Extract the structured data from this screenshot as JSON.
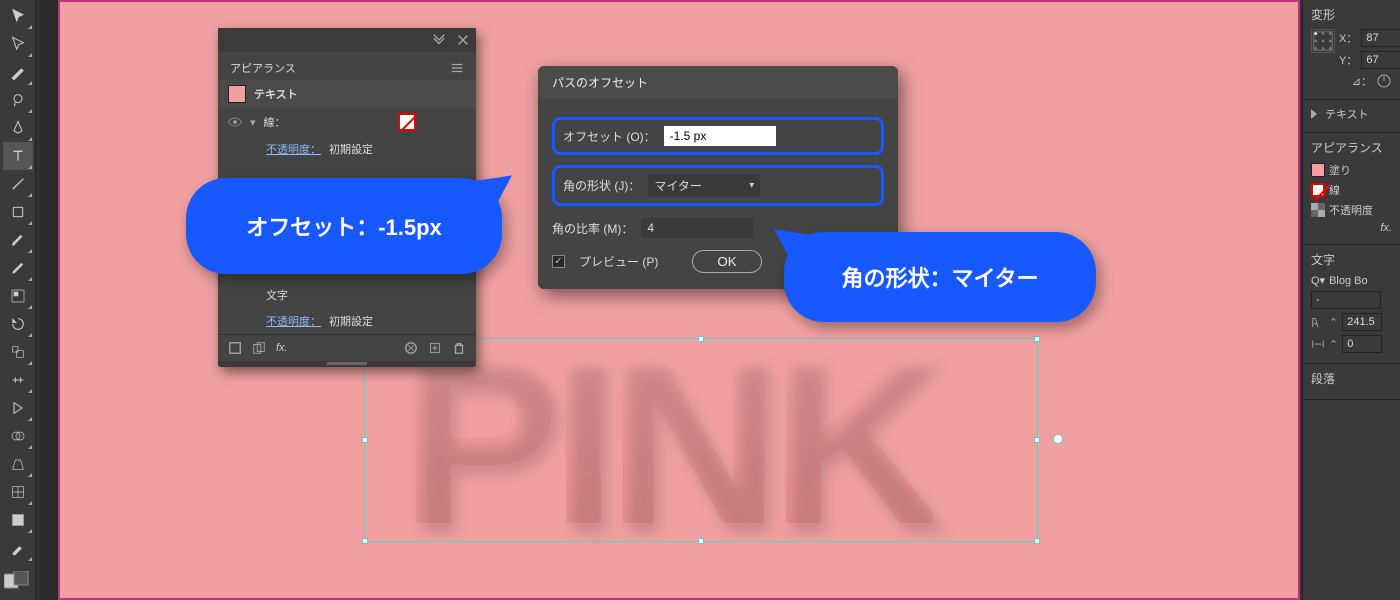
{
  "canvas": {
    "text": "PINK"
  },
  "appearance": {
    "tab_title": "アピアランス",
    "object_type": "テキスト",
    "stroke_label": "線：",
    "opacity_label": "不透明度：",
    "opacity_value": "初期設定",
    "char_label": "文字",
    "fx_label": "fx."
  },
  "dialog": {
    "title": "パスのオフセット",
    "offset_label": "オフセット (O)：",
    "offset_value": "-1.5 px",
    "corner_label": "角の形状 (J)：",
    "corner_value": "マイター",
    "ratio_label": "角の比率 (M)：",
    "ratio_value": "4",
    "preview_label": "プレビュー (P)",
    "ok_label": "OK"
  },
  "bubbles": {
    "offset_note": "オフセット：-1.5px",
    "corner_note": "角の形状：マイター"
  },
  "right": {
    "transform_title": "変形",
    "x_label": "X：",
    "x_value": "87",
    "y_label": "Y：",
    "y_value": "67",
    "angle_label": "⊿：",
    "text_panel": "テキスト",
    "appearance_title": "アピアランス",
    "fill_label": "塗り",
    "stroke_label": "線",
    "opacity_label": "不透明度",
    "fx_label": "fx.",
    "char_title": "文字",
    "font_search_prefix": "Q▾",
    "font_name": "Blog Bo",
    "font_variant": "-",
    "size_value": "241.5",
    "tracking_value": "0",
    "para_title": "段落"
  },
  "tool_icons": [
    "selection",
    "direct-selection",
    "magic-wand",
    "lasso",
    "pen",
    "type",
    "line",
    "rectangle",
    "paintbrush",
    "pencil",
    "eraser",
    "rotate",
    "scale",
    "width",
    "free-transform",
    "shape-builder",
    "perspective",
    "mesh",
    "gradient",
    "eyedropper",
    "blend",
    "symbol-sprayer",
    "graph",
    "artboard",
    "slice",
    "hand",
    "zoom"
  ]
}
